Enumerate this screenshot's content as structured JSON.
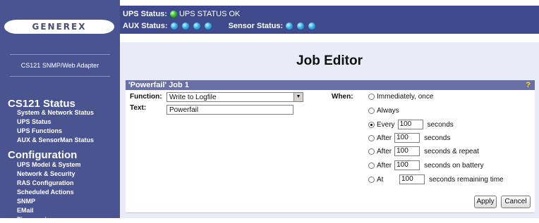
{
  "brand": {
    "logo_text": "GENEREX",
    "adapter_label": "CS121 SNMP/Web Adapter"
  },
  "status": {
    "ups_label": "UPS Status:",
    "ups_text": "UPS STATUS OK",
    "aux_label": "AUX Status:",
    "sensor_label": "Sensor Status:",
    "colors": {
      "ok": "#37c22a",
      "info": "#3ab2e6"
    }
  },
  "sidebar": {
    "status_title": "CS121 Status",
    "status_items": [
      "System & Network Status",
      "UPS Status",
      "UPS Functions",
      "AUX & SensorMan Status"
    ],
    "config_title": "Configuration",
    "config_items": [
      "UPS Model & System",
      "Network & Security",
      "RAS Configuration",
      "Scheduled Actions",
      "SNMP",
      "EMail",
      "Timeservice"
    ]
  },
  "editor": {
    "title": "Job Editor",
    "panel_title": "'Powerfail' Job 1",
    "help": "?",
    "function_label": "Function:",
    "function_value": "Write to Logfile",
    "text_label": "Text:",
    "text_value": "Powerfail",
    "when_label": "When:",
    "options": [
      {
        "label": "Immediately, once",
        "selected": false
      },
      {
        "label": "Always",
        "selected": false
      },
      {
        "pre": "Every",
        "value": "100",
        "post": "seconds",
        "selected": true
      },
      {
        "pre": "After",
        "value": "100",
        "post": "seconds",
        "selected": false
      },
      {
        "pre": "After",
        "value": "100",
        "post": "seconds & repeat",
        "selected": false
      },
      {
        "pre": "After",
        "value": "100",
        "post": "seconds on battery",
        "selected": false
      },
      {
        "pre": "At",
        "value": "100",
        "post": "seconds remaining time",
        "selected": false
      }
    ],
    "apply_label": "Apply",
    "cancel_label": "Cancel"
  }
}
